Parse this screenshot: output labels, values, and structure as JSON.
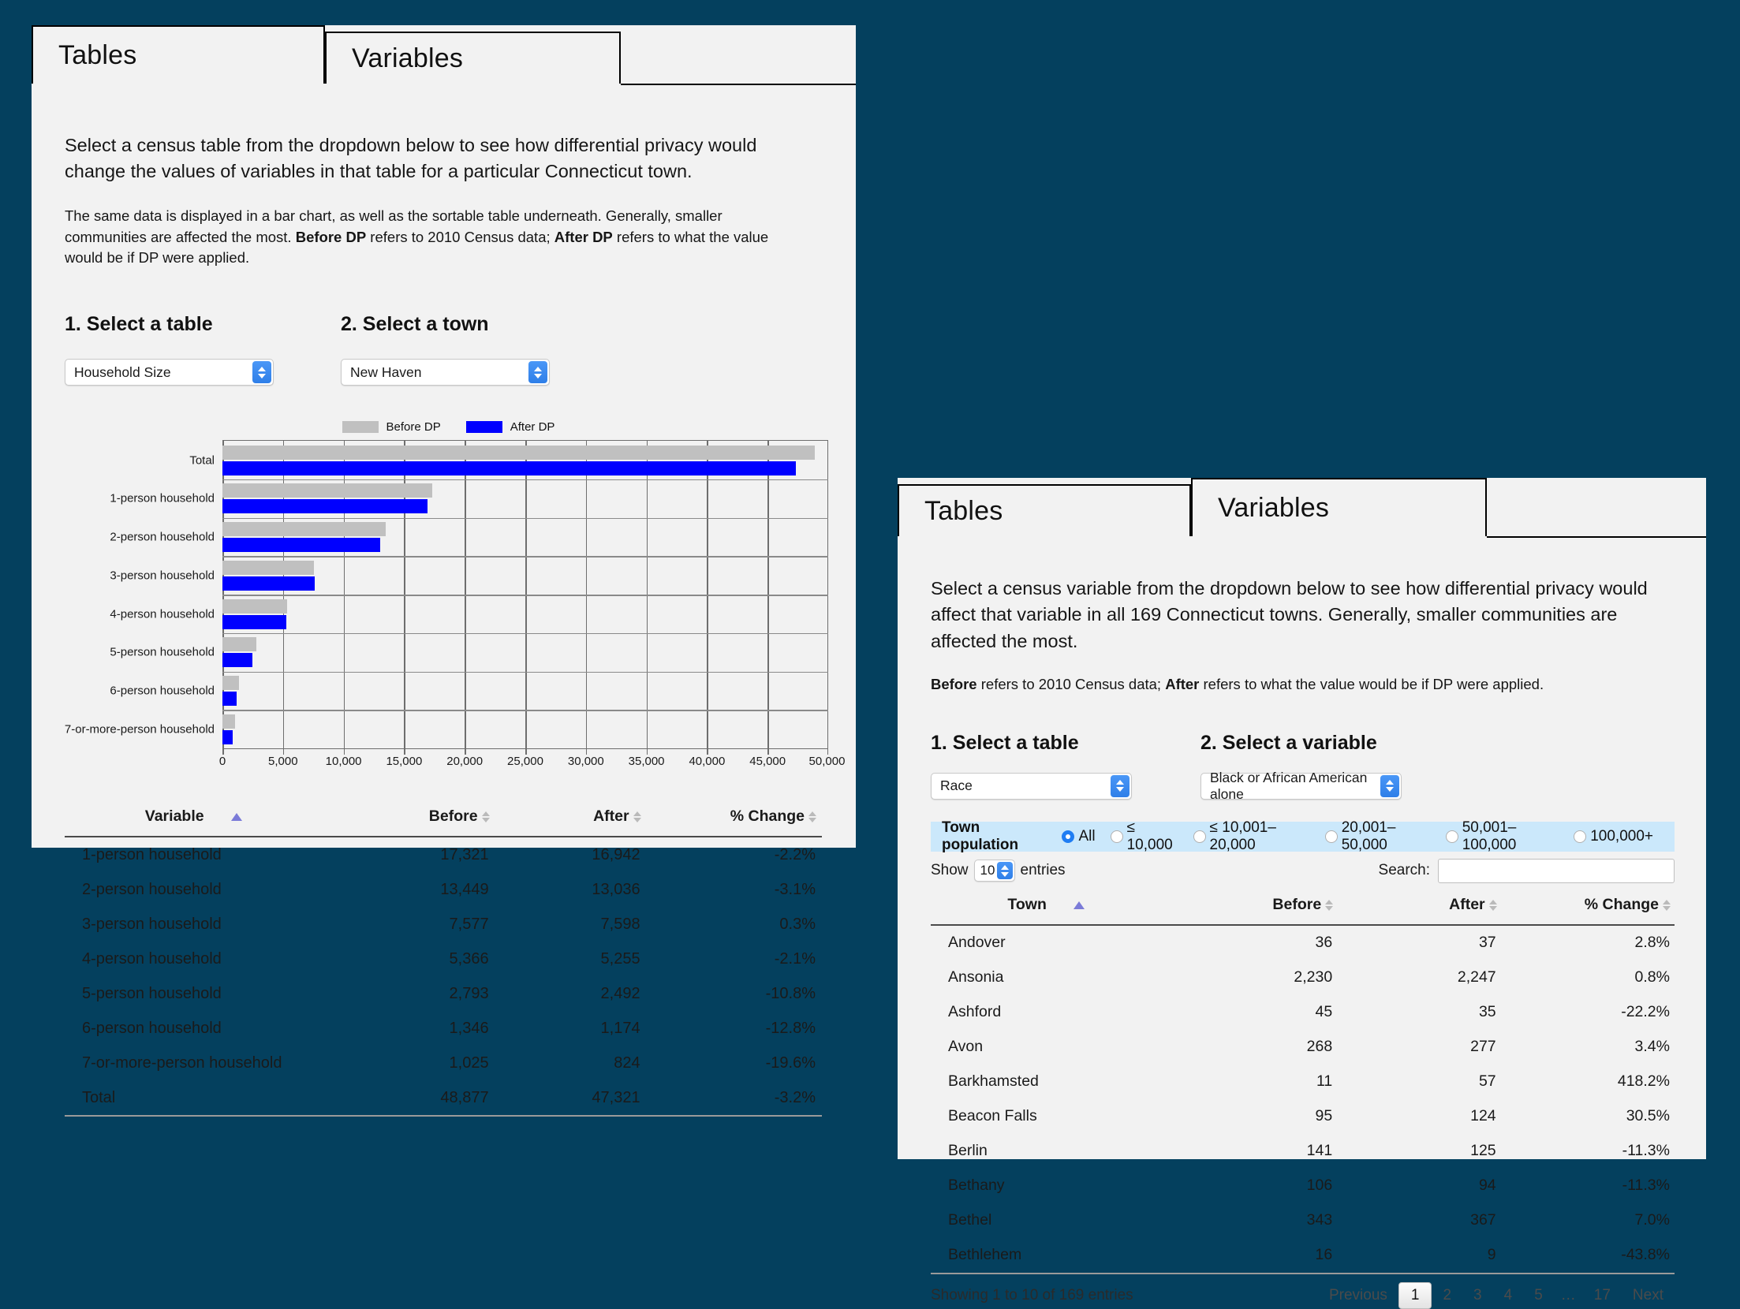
{
  "left_panel": {
    "tabs": [
      {
        "label": "Tables",
        "active": true
      },
      {
        "label": "Variables",
        "active": false
      }
    ],
    "lead": "Select a census table from the dropdown below to see how differential privacy would change the values of variables in that table for a particular Connecticut town.",
    "sub_pre": "The same data is displayed in a bar chart, as well as the sortable table underneath. Generally, smaller communities are affected the most. ",
    "sub_b1": "Before DP",
    "sub_mid1": " refers to 2010 Census data; ",
    "sub_b2": "After DP",
    "sub_post": " refers to what the value would be if DP were applied.",
    "step1_title": "1. Select a table",
    "step2_title": "2. Select a town",
    "table_select_value": "Household Size",
    "town_select_value": "New Haven",
    "table_headers": [
      "Variable",
      "Before",
      "After",
      "% Change"
    ],
    "rows": [
      {
        "variable": "1-person household",
        "before": "17,321",
        "after": "16,942",
        "change": "-2.2%"
      },
      {
        "variable": "2-person household",
        "before": "13,449",
        "after": "13,036",
        "change": "-3.1%"
      },
      {
        "variable": "3-person household",
        "before": "7,577",
        "after": "7,598",
        "change": "0.3%"
      },
      {
        "variable": "4-person household",
        "before": "5,366",
        "after": "5,255",
        "change": "-2.1%"
      },
      {
        "variable": "5-person household",
        "before": "2,793",
        "after": "2,492",
        "change": "-10.8%"
      },
      {
        "variable": "6-person household",
        "before": "1,346",
        "after": "1,174",
        "change": "-12.8%"
      },
      {
        "variable": "7-or-more-person household",
        "before": "1,025",
        "after": "824",
        "change": "-19.6%"
      },
      {
        "variable": "Total",
        "before": "48,877",
        "after": "47,321",
        "change": "-3.2%"
      }
    ]
  },
  "right_panel": {
    "tabs": [
      {
        "label": "Tables",
        "active": false
      },
      {
        "label": "Variables",
        "active": true
      }
    ],
    "lead": "Select a census variable from the dropdown below to see how differential privacy would affect that variable in all 169 Connecticut towns. Generally, smaller communities are affected the most.",
    "sub_b1": "Before",
    "sub_mid1": " refers to 2010 Census data; ",
    "sub_b2": "After",
    "sub_post": " refers to what the value would be if DP were applied.",
    "step1_title": "1. Select a table",
    "step2_title": "2. Select a variable",
    "table_select_value": "Race",
    "variable_select_value": "Black or African American alone",
    "filter": {
      "title": "Town population",
      "options": [
        {
          "label": "All",
          "selected": true
        },
        {
          "label": "≤ 10,000",
          "selected": false
        },
        {
          "label": "≤ 10,001–20,000",
          "selected": false
        },
        {
          "label": "20,001–50,000",
          "selected": false
        },
        {
          "label": "50,001–100,000",
          "selected": false
        },
        {
          "label": "100,000+",
          "selected": false
        }
      ]
    },
    "show_label": "Show",
    "entries_label": "entries",
    "page_length": "10",
    "search_label": "Search:",
    "search_value": "",
    "search_placeholder": "",
    "table_headers": [
      "Town",
      "Before",
      "After",
      "% Change"
    ],
    "rows": [
      {
        "town": "Andover",
        "before": "36",
        "after": "37",
        "change": "2.8%"
      },
      {
        "town": "Ansonia",
        "before": "2,230",
        "after": "2,247",
        "change": "0.8%"
      },
      {
        "town": "Ashford",
        "before": "45",
        "after": "35",
        "change": "-22.2%"
      },
      {
        "town": "Avon",
        "before": "268",
        "after": "277",
        "change": "3.4%"
      },
      {
        "town": "Barkhamsted",
        "before": "11",
        "after": "57",
        "change": "418.2%"
      },
      {
        "town": "Beacon Falls",
        "before": "95",
        "after": "124",
        "change": "30.5%"
      },
      {
        "town": "Berlin",
        "before": "141",
        "after": "125",
        "change": "-11.3%"
      },
      {
        "town": "Bethany",
        "before": "106",
        "after": "94",
        "change": "-11.3%"
      },
      {
        "town": "Bethel",
        "before": "343",
        "after": "367",
        "change": "7.0%"
      },
      {
        "town": "Bethlehem",
        "before": "16",
        "after": "9",
        "change": "-43.8%"
      }
    ],
    "showing_text": "Showing 1 to 10 of 169 entries",
    "pagination": {
      "previous": "Previous",
      "pages": [
        "1",
        "2",
        "3",
        "4",
        "5",
        "…",
        "17"
      ],
      "current": "1",
      "next": "Next"
    }
  },
  "chart_data": {
    "type": "bar",
    "orientation": "horizontal",
    "title": "",
    "xlabel": "",
    "ylabel": "",
    "xlim": [
      0,
      50000
    ],
    "xticks": [
      0,
      5000,
      10000,
      15000,
      20000,
      25000,
      30000,
      35000,
      40000,
      45000,
      50000
    ],
    "xtick_labels": [
      "0",
      "5,000",
      "10,000",
      "15,000",
      "20,000",
      "25,000",
      "30,000",
      "35,000",
      "40,000",
      "45,000",
      "50,000"
    ],
    "grid": true,
    "legend": [
      "Before DP",
      "After DP"
    ],
    "legend_position": "top-center",
    "colors": {
      "before": "#c0c0c0",
      "after": "#0000ff"
    },
    "categories": [
      "Total",
      "1-person household",
      "2-person household",
      "3-person household",
      "4-person household",
      "5-person household",
      "6-person household",
      "7-or-more-person household"
    ],
    "series": [
      {
        "name": "Before DP",
        "values": [
          48877,
          17321,
          13449,
          7577,
          5366,
          2793,
          1346,
          1025
        ]
      },
      {
        "name": "After DP",
        "values": [
          47321,
          16942,
          13036,
          7598,
          5255,
          2492,
          1174,
          824
        ]
      }
    ]
  },
  "colors": {
    "background": "#04405e",
    "panel": "#f2f2f2",
    "accent_blue": "#0000ff",
    "gray_bar": "#c0c0c0",
    "filter_bar": "#cbe8fb",
    "select_arrow": "#3d8cf0"
  }
}
